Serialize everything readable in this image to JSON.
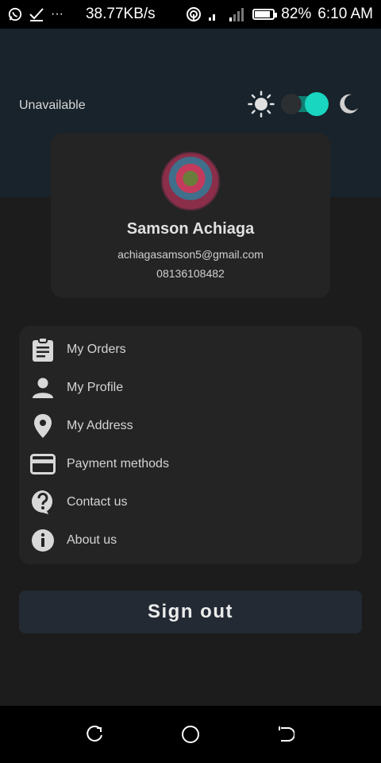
{
  "status_bar": {
    "left_icons": [
      "whatsapp-icon",
      "check-icon",
      "more-icon"
    ],
    "speed": "38.77KB/s",
    "battery": "82%",
    "time": "6:10 AM"
  },
  "header": {
    "availability": "Unavailable",
    "theme_toggle": {
      "state": "dark",
      "accent": "#18d6bf"
    }
  },
  "profile": {
    "name": "Samson Achiaga",
    "email": "achiagasamson5@gmail.com",
    "phone": "08136108482"
  },
  "menu": {
    "items": [
      {
        "label": "My Orders",
        "icon": "clipboard-icon"
      },
      {
        "label": "My Profile",
        "icon": "person-icon"
      },
      {
        "label": "My Address",
        "icon": "location-pin-icon"
      },
      {
        "label": "Payment methods",
        "icon": "credit-card-icon"
      },
      {
        "label": "Contact us",
        "icon": "help-icon"
      },
      {
        "label": "About us",
        "icon": "info-icon"
      }
    ]
  },
  "signout": {
    "label": "Sign out"
  },
  "colors": {
    "header_bg": "#18232b",
    "card_bg": "#242424",
    "accent": "#18d6bf",
    "signout_bg": "#232a33"
  }
}
